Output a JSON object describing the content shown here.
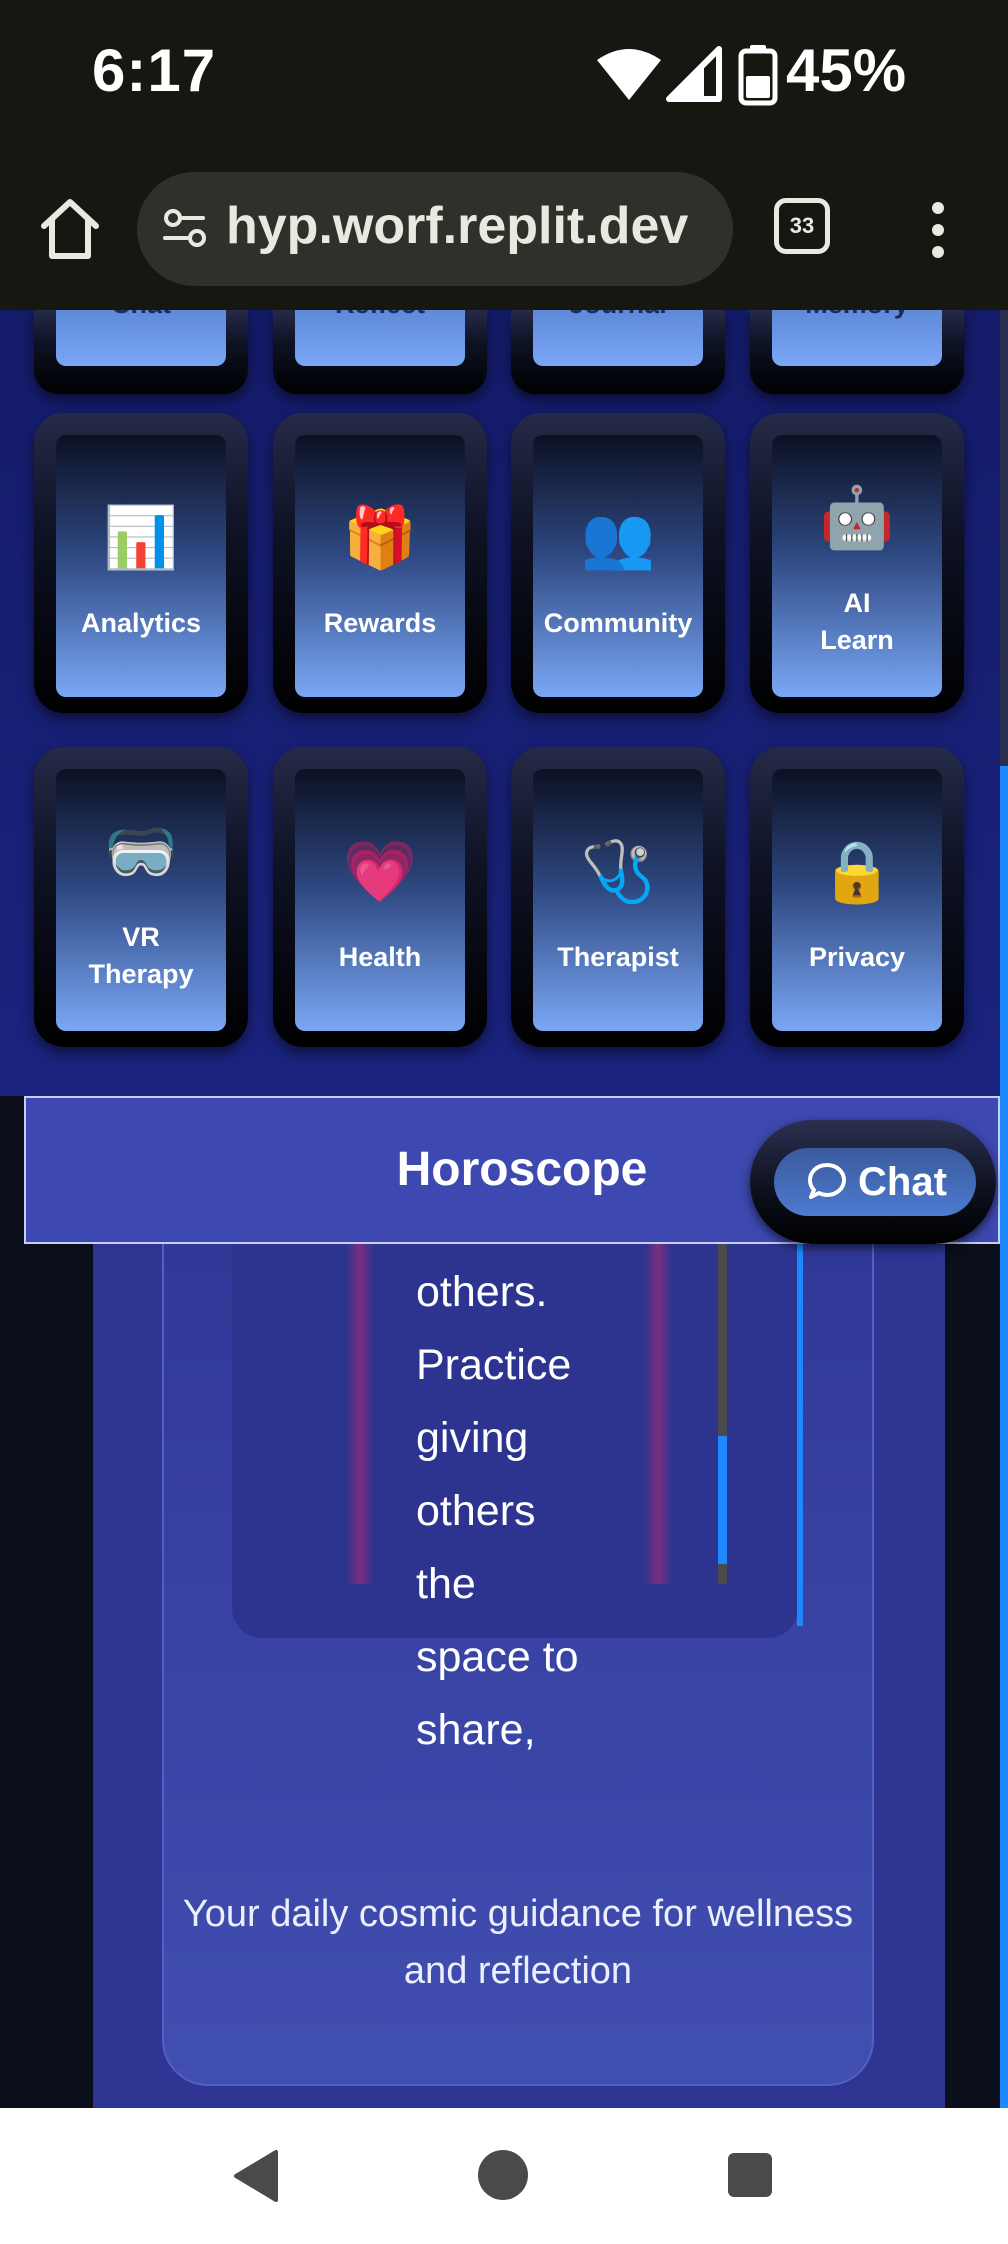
{
  "status_bar": {
    "time": "6:17",
    "battery_percent": "45%"
  },
  "browser": {
    "url": "hyp.worf.replit.dev",
    "tab_count": "33"
  },
  "tiles_top_partial": [
    {
      "label": "Chat"
    },
    {
      "label": "Reflect"
    },
    {
      "label": "Journal"
    },
    {
      "label": "Memory"
    }
  ],
  "tiles": [
    {
      "label": "Analytics",
      "icon": "📊"
    },
    {
      "label": "Rewards",
      "icon": "🎁"
    },
    {
      "label": "Community",
      "icon": "👥"
    },
    {
      "label": "AI\nLearn",
      "icon": "🤖"
    },
    {
      "label": "VR\nTherapy",
      "icon": "🥽"
    },
    {
      "label": "Health",
      "icon": "💗"
    },
    {
      "label": "Therapist",
      "icon": "🩺"
    },
    {
      "label": "Privacy",
      "icon": "🔒"
    }
  ],
  "horoscope": {
    "title": "Horoscope",
    "text_lines": [
      "others.",
      "Practice",
      "giving",
      "others",
      "the",
      "space to",
      "share,"
    ],
    "subtitle": "Your daily cosmic guidance for wellness and reflection"
  },
  "chat_button": {
    "label": "Chat"
  },
  "colors": {
    "accent": "#1e88ff",
    "header": "#3d49b0",
    "panel": "#2e3592"
  }
}
